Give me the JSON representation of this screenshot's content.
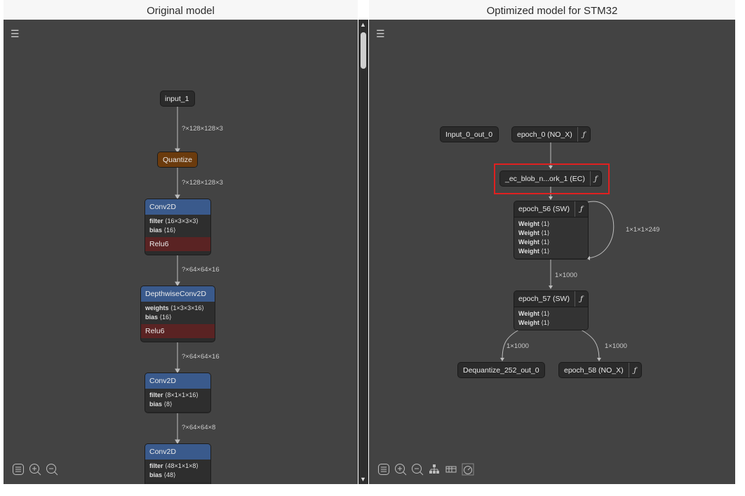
{
  "left": {
    "title": "Original model",
    "nodes": {
      "input": "input_1",
      "quantize": "Quantize",
      "conv1": {
        "name": "Conv2D",
        "k1": "filter",
        "v1": "⟨16×3×3×3⟩",
        "k2": "bias",
        "v2": "⟨16⟩",
        "act": "Relu6"
      },
      "dw": {
        "name": "DepthwiseConv2D",
        "k1": "weights",
        "v1": "⟨1×3×3×16⟩",
        "k2": "bias",
        "v2": "⟨16⟩",
        "act": "Relu6"
      },
      "conv2": {
        "name": "Conv2D",
        "k1": "filter",
        "v1": "⟨8×1×1×16⟩",
        "k2": "bias",
        "v2": "⟨8⟩"
      },
      "conv3": {
        "name": "Conv2D",
        "k1": "filter",
        "v1": "⟨48×1×1×8⟩",
        "k2": "bias",
        "v2": "⟨48⟩"
      }
    },
    "edges": [
      "?×128×128×3",
      "?×128×128×3",
      "?×64×64×16",
      "?×64×64×16",
      "?×64×64×8"
    ]
  },
  "right": {
    "title": "Optimized model for STM32",
    "nodes": {
      "input0": "Input_0_out_0",
      "epoch0": "epoch_0 (NO_X)",
      "ecblob": "_ec_blob_n...ork_1 (EC)",
      "epoch56": {
        "name": "epoch_56 (SW)",
        "weights": [
          "Weight",
          "Weight",
          "Weight",
          "Weight"
        ],
        "shape": "⟨1⟩"
      },
      "epoch57": {
        "name": "epoch_57 (SW)",
        "weights": [
          "Weight",
          "Weight"
        ],
        "shape": "⟨1⟩"
      },
      "dequant": "Dequantize_252_out_0",
      "epoch58": "epoch_58 (NO_X)"
    },
    "edges": {
      "loop": "1×1×1×249",
      "e56_57": "1×1000",
      "e57_deq": "1×1000",
      "e57_58": "1×1000"
    },
    "func_symbol": "ƒ"
  },
  "icons": [
    "menu-icon",
    "list-icon",
    "zoom-in-icon",
    "zoom-out-icon",
    "hierarchy-icon",
    "layout-icon",
    "gauge-icon"
  ],
  "colors": {
    "canvas": "#434343",
    "conv": "#3a5a8c",
    "quantize": "#6b3b0d",
    "relu": "#5a2323",
    "highlight": "#e02020"
  }
}
